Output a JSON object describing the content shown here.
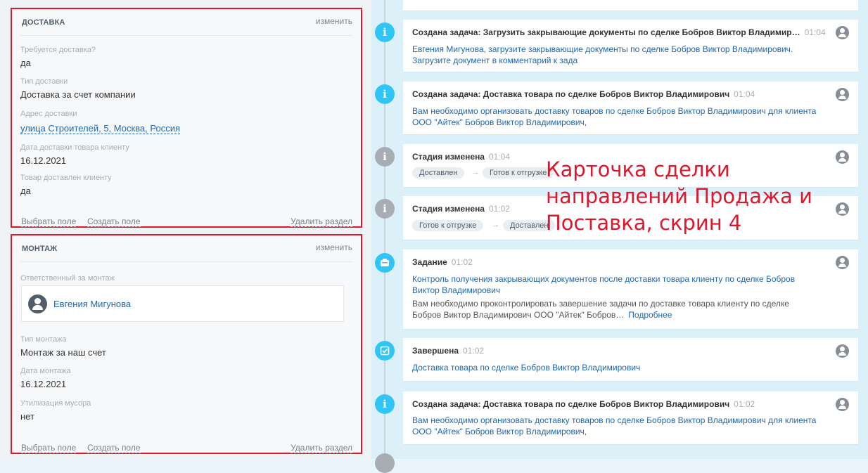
{
  "delivery": {
    "title": "ДОСТАВКА",
    "edit": "изменить",
    "fields": [
      {
        "label": "Требуется доставка?",
        "value": "да"
      },
      {
        "label": "Тип доставки",
        "value": "Доставка за счет компании"
      },
      {
        "label": "Адрес доставки",
        "value": "улица Строителей, 5, Москва, Россия"
      },
      {
        "label": "Дата доставки товара клиенту",
        "value": "16.12.2021"
      },
      {
        "label": "Товар доставлен клиенту",
        "value": "да"
      }
    ],
    "footer": {
      "select_field": "Выбрать поле",
      "create_field": "Создать поле",
      "delete_section": "Удалить раздел"
    }
  },
  "montage": {
    "title": "МОНТАЖ",
    "edit": "изменить",
    "responsible_label": "Ответственный за монтаж",
    "responsible_name": "Евгения Мигунова",
    "fields": [
      {
        "label": "Тип монтажа",
        "value": "Монтаж за наш счет"
      },
      {
        "label": "Дата монтажа",
        "value": "16.12.2021"
      },
      {
        "label": "Утилизация мусора",
        "value": "нет"
      }
    ],
    "footer": {
      "select_field": "Выбрать поле",
      "create_field": "Создать поле",
      "delete_section": "Удалить раздел"
    }
  },
  "timeline": [
    {
      "type": "info",
      "title": "Создана задача: Загрузить закрывающие документы по сделке Бобров Виктор Владимир…",
      "time": "01:04",
      "text": "Евгения Мигунова, загрузите закрывающие документы по сделке Бобров Виктор Владимирович. Загрузите документ в комментарий к зада"
    },
    {
      "type": "info",
      "title": "Создана задача: Доставка товара по сделке Бобров Виктор Владимирович",
      "time": "01:04",
      "text": "Вам необходимо организовать доставку товаров по сделке Бобров Виктор Владимирович для клиента ООО \"Айтек\" Бобров Виктор Владимирович,"
    },
    {
      "type": "stage",
      "title": "Стадия изменена",
      "time": "01:04",
      "from": "Доставлен",
      "to": "Готов к отгрузке"
    },
    {
      "type": "stage",
      "title": "Стадия изменена",
      "time": "01:02",
      "from": "Готов к отгрузке",
      "to": "Доставлен"
    },
    {
      "type": "task",
      "title": "Задание",
      "time": "01:02",
      "text": "Контроль получения закрывающих документов после доставки товара клиенту по сделке Бобров Виктор Владимирович",
      "desc": "Вам необходимо проконтролировать завершение задачи по доставке товара клиенту по сделке Бобров Виктор Владимирович ООО \"Айтек\" Бобров…",
      "more": "Подробнее"
    },
    {
      "type": "done",
      "title": "Завершена",
      "time": "01:02",
      "text": "Доставка товара по сделке Бобров Виктор Владимирович"
    },
    {
      "type": "info",
      "title": "Создана задача: Доставка товара по сделке Бобров Виктор Владимирович",
      "time": "01:02",
      "text": "Вам необходимо организовать доставку товаров по сделке Бобров Виктор Владимирович для клиента ООО \"Айтек\" Бобров Виктор Владимирович,"
    }
  ],
  "overlay_caption": "Карточка сделки направлений Продажа и Поставка, скрин 4",
  "colors": {
    "accent_red": "#e0162b",
    "link_blue": "#2067b0",
    "timeline_blue": "#2fc6f6",
    "timeline_gray": "#a8adb4"
  }
}
